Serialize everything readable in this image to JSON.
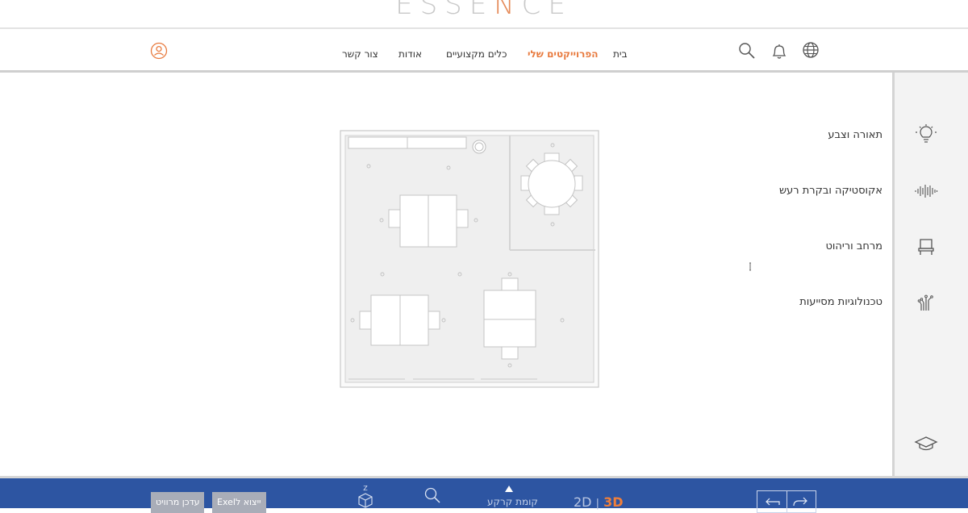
{
  "brand": {
    "logo_left": "ESSE",
    "logo_accent": "N",
    "logo_right": "CE",
    "accent_color": "#e87a3e"
  },
  "nav": {
    "items": [
      {
        "label": "בית"
      },
      {
        "label": "הפרוייקטים שלי",
        "active": true
      },
      {
        "label": "כלים מקצועיים"
      },
      {
        "label": "אודות"
      },
      {
        "label": "צור קשר"
      }
    ]
  },
  "header_icons": {
    "globe": "globe-icon",
    "bell": "bell-icon",
    "search": "search-icon",
    "user": "user-icon"
  },
  "sidebar": {
    "categories": [
      {
        "label": "תאורה וצבע",
        "icon": "lightbulb-icon"
      },
      {
        "label": "אקוסטיקה ובקרת רעש",
        "icon": "soundwave-icon"
      },
      {
        "label": "מרחב וריהוט",
        "icon": "chair-icon"
      },
      {
        "label": "טכנולוגיות מסייעות",
        "icon": "hand-tech-icon"
      }
    ],
    "bottom_icon": "graduation-cap-icon"
  },
  "bottom_bar": {
    "update_project": "עדכן מרוויט",
    "export_excel": "ייצוא לExel",
    "axis_label": "Z",
    "floor_label": "קומת קרקע",
    "view_2d": "2D",
    "view_separator": "|",
    "view_3d": "3D",
    "active_view": "3D",
    "bar_color": "#2d55a2"
  }
}
